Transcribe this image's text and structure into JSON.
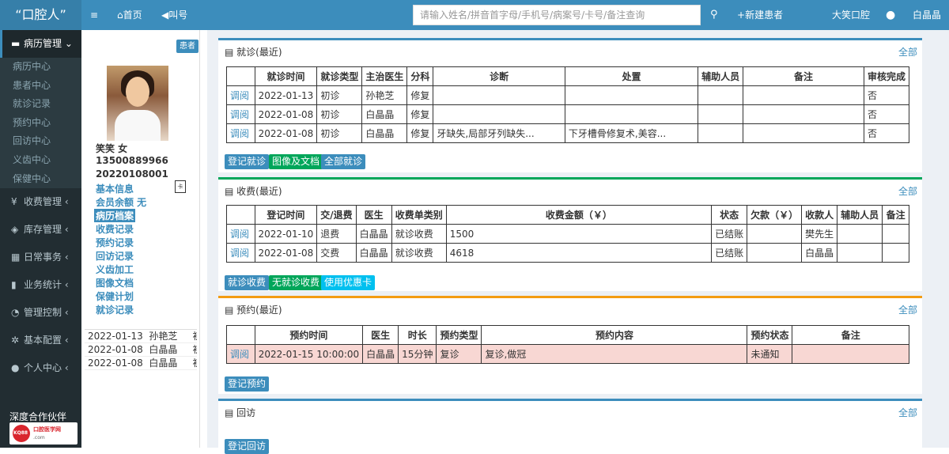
{
  "header": {
    "logo": "“口腔人”",
    "menu_icon": "menu-icon",
    "home": "首页",
    "call": "叫号",
    "search_placeholder": "请输入姓名/拼音首字母/手机号/病案号/卡号/备注查询",
    "new_patient": "新建患者",
    "clinic": "大笑口腔",
    "user": "白晶晶"
  },
  "sidebar": {
    "groups": [
      {
        "label": "病历管理",
        "icon": "bed-icon",
        "active": true
      },
      {
        "label": "收费管理",
        "icon": "yen-icon"
      },
      {
        "label": "库存管理",
        "icon": "cubes-icon"
      },
      {
        "label": "日常事务",
        "icon": "calendar-icon"
      },
      {
        "label": "业务统计",
        "icon": "bar-chart-icon"
      },
      {
        "label": "管理控制",
        "icon": "dashboard-icon"
      },
      {
        "label": "基本配置",
        "icon": "gear-icon"
      },
      {
        "label": "个人中心",
        "icon": "user-icon"
      }
    ],
    "sub_items": [
      "病历中心",
      "患者中心",
      "就诊记录",
      "预约中心",
      "回访中心",
      "义齿中心",
      "保健中心"
    ],
    "partner_label": "深度合作伙伴",
    "partner_logo_text": "口腔医学网",
    "partner_logo_sub": ".com",
    "partner_logo_badge": "KQ88"
  },
  "patient": {
    "badge": "患者",
    "name_gender": "笑笑 女",
    "phone": "13500889966",
    "record_no": "20220108001",
    "card_icon_text": "卡",
    "links": [
      "基本信息",
      "会员余额 无",
      "病历档案",
      "收费记录",
      "预约记录",
      "回访记录",
      "义齿加工",
      "图像文档",
      "保健计划",
      "就诊记录"
    ],
    "active_link": 2,
    "visits": [
      {
        "date": "2022-01-13",
        "doctor": "孙艳芝",
        "type": "初"
      },
      {
        "date": "2022-01-08",
        "doctor": "白晶晶",
        "type": "初"
      },
      {
        "date": "2022-01-08",
        "doctor": "白晶晶",
        "type": "初"
      }
    ]
  },
  "visit_section": {
    "title": "就诊(最近)",
    "more": "全部",
    "headers": [
      "",
      "就诊时间",
      "就诊类型",
      "主治医生",
      "分科",
      "诊断",
      "处置",
      "辅助人员",
      "备注",
      "审核完成"
    ],
    "rows": [
      [
        "调阅",
        "2022-01-13",
        "初诊",
        "孙艳芝",
        "修复",
        "",
        "",
        "",
        "",
        "否"
      ],
      [
        "调阅",
        "2022-01-08",
        "初诊",
        "白晶晶",
        "修复",
        "",
        "",
        "",
        "",
        "否"
      ],
      [
        "调阅",
        "2022-01-08",
        "初诊",
        "白晶晶",
        "修复",
        "牙缺失,局部牙列缺失...",
        "下牙槽骨修复术,美容...",
        "",
        "",
        "否"
      ]
    ],
    "buttons": [
      "登记就诊",
      "图像及文档",
      "全部就诊"
    ]
  },
  "fee_section": {
    "title": "收费(最近)",
    "more": "全部",
    "headers": [
      "",
      "登记时间",
      "交/退费",
      "医生",
      "收费单类别",
      "收费金额（￥）",
      "状态",
      "欠款（￥）",
      "收款人",
      "辅助人员",
      "备注"
    ],
    "rows": [
      [
        "调阅",
        "2022-01-10",
        "退费",
        "白晶晶",
        "就诊收费",
        "1500",
        "已结账",
        "",
        "樊先生",
        "",
        ""
      ],
      [
        "调阅",
        "2022-01-08",
        "交费",
        "白晶晶",
        "就诊收费",
        "4618",
        "已结账",
        "",
        "白晶晶",
        "",
        ""
      ]
    ],
    "buttons": [
      "就诊收费",
      "无就诊收费",
      "使用优惠卡"
    ]
  },
  "appt_section": {
    "title": "预约(最近)",
    "more": "全部",
    "headers": [
      "",
      "预约时间",
      "医生",
      "时长",
      "预约类型",
      "预约内容",
      "预约状态",
      "备注"
    ],
    "rows": [
      [
        "调阅",
        "2022-01-15 10:00:00",
        "白晶晶",
        "15分钟",
        "复诊",
        "复诊,做冠",
        "未通知",
        ""
      ]
    ],
    "button": "登记预约"
  },
  "followup_section": {
    "title": "回访",
    "more": "全部",
    "button": "登记回访"
  },
  "colors": {
    "primary": "#3c8dbc",
    "sidebar": "#222d32",
    "success": "#00a65a",
    "warning": "#f39c12",
    "info": "#00c0ef",
    "pink_row": "#f8d7d3"
  }
}
